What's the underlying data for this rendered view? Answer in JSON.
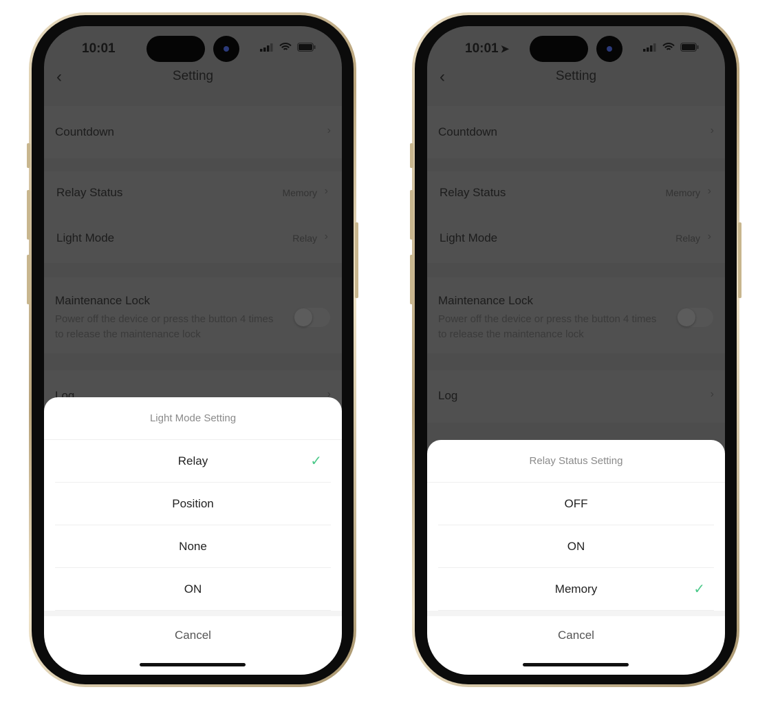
{
  "phones": [
    {
      "status": {
        "time": "10:01",
        "location_arrow": false
      },
      "header": {
        "title": "Setting"
      },
      "settings": {
        "countdown": "Countdown",
        "relay_status": "Relay Status",
        "relay_status_value": "Memory",
        "light_mode": "Light Mode",
        "light_mode_value": "Relay",
        "maintenance_lock": "Maintenance Lock",
        "maintenance_desc": "Power off the device or press the button 4 times to release the maintenance lock",
        "maintenance_lock_on": false,
        "log": "Log"
      },
      "sheet": {
        "title": "Light Mode Setting",
        "options": [
          "Relay",
          "Position",
          "None",
          "ON"
        ],
        "selected": "Relay",
        "cancel": "Cancel"
      }
    },
    {
      "status": {
        "time": "10:01",
        "location_arrow": true
      },
      "header": {
        "title": "Setting"
      },
      "settings": {
        "countdown": "Countdown",
        "relay_status": "Relay Status",
        "relay_status_value": "Memory",
        "light_mode": "Light Mode",
        "light_mode_value": "Relay",
        "maintenance_lock": "Maintenance Lock",
        "maintenance_desc": "Power off the device or press the button 4 times to release the maintenance lock",
        "maintenance_lock_on": false,
        "log": "Log"
      },
      "sheet": {
        "title": "Relay Status Setting",
        "options": [
          "OFF",
          "ON",
          "Memory"
        ],
        "selected": "Memory",
        "cancel": "Cancel"
      }
    }
  ],
  "colors": {
    "check": "#4cc98a",
    "overlay": "#4d4d4d"
  }
}
